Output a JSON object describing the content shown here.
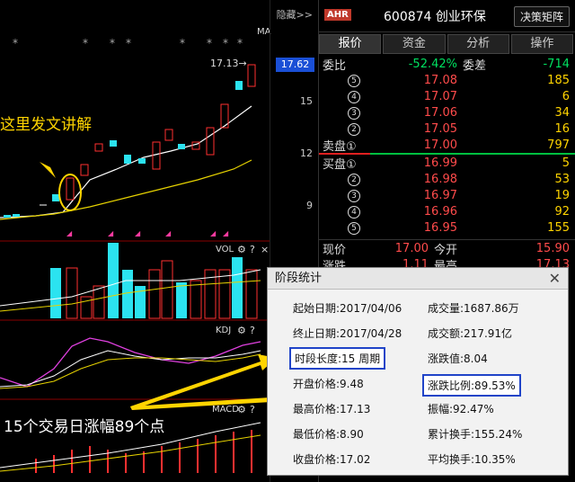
{
  "chart": {
    "hide_label": "隐藏>>",
    "ma_label": "MA",
    "price_tag": "17.13→",
    "current_price_box": "17.62",
    "y_ticks": [
      "15",
      "12",
      "9"
    ],
    "vol_label": "VOL",
    "kdj_label": "KDJ",
    "macd_label": "MACD",
    "gear_icon": "gear-icon",
    "help_icon": "?",
    "close_icon": "×",
    "annotation_1": "这里发文讲解",
    "annotation_2": "15个交易日涨幅89个点"
  },
  "quote": {
    "badge": "AHR",
    "code_name": "600874 创业环保",
    "decision_button": "决策矩阵",
    "tabs": [
      "报价",
      "资金",
      "分析",
      "操作"
    ],
    "ratio_label": "委比",
    "ratio_value": "-52.42%",
    "diff_label": "委差",
    "diff_value": "-714",
    "asks": [
      {
        "level": "5",
        "price": "17.08",
        "vol": "185"
      },
      {
        "level": "4",
        "price": "17.07",
        "vol": "6"
      },
      {
        "level": "3",
        "price": "17.06",
        "vol": "34"
      },
      {
        "level": "2",
        "price": "17.05",
        "vol": "16"
      }
    ],
    "ask1": {
      "label": "卖盘①",
      "price": "17.00",
      "vol": "797"
    },
    "bid1": {
      "label": "买盘①",
      "price": "16.99",
      "vol": "5"
    },
    "bids": [
      {
        "level": "2",
        "price": "16.98",
        "vol": "53"
      },
      {
        "level": "3",
        "price": "16.97",
        "vol": "19"
      },
      {
        "level": "4",
        "price": "16.96",
        "vol": "92"
      },
      {
        "level": "5",
        "price": "16.95",
        "vol": "155"
      }
    ],
    "now_label": "现价",
    "now_value": "17.00",
    "open_label": "今开",
    "open_value": "15.90",
    "chg_label": "涨跌",
    "chg_value": "1.11",
    "high_label": "最高",
    "high_value": "17.13"
  },
  "dialog": {
    "title": "阶段统计",
    "start_date": "起始日期:2017/04/06",
    "end_date": "终止日期:2017/04/28",
    "period": "时段长度:15 周期",
    "open_price": "开盘价格:9.48",
    "high_price": "最高价格:17.13",
    "low_price": "最低价格:8.90",
    "close_price": "收盘价格:17.02",
    "volume": "成交量:1687.86万",
    "amount": "成交额:217.91亿",
    "change_value": "涨跌值:8.04",
    "change_ratio": "涨跌比例:89.53%",
    "amplitude": "振幅:92.47%",
    "cum_turnover": "累计换手:155.24%",
    "avg_turnover": "平均换手:10.35%"
  }
}
